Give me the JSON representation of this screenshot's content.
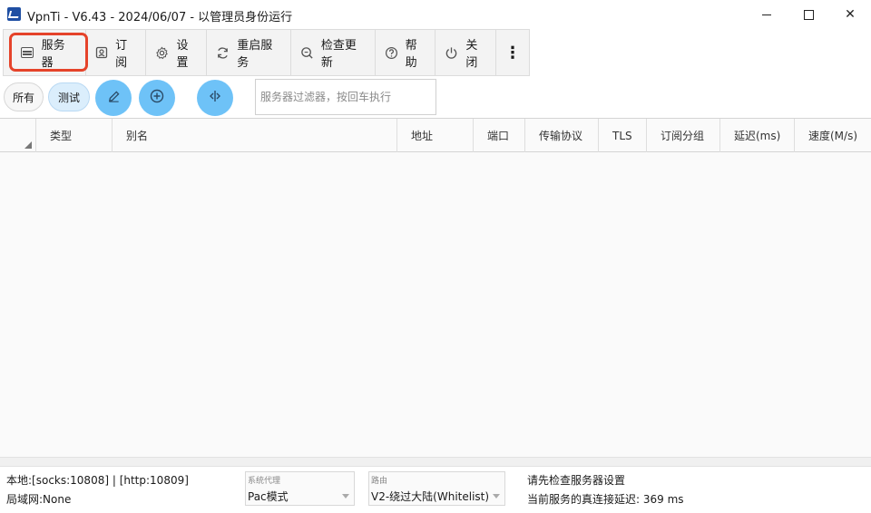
{
  "window": {
    "title": "VpnTi - V6.43 - 2024/06/07 - 以管理员身份运行",
    "controls": {
      "minimize": "",
      "maximize": "",
      "close": "✕"
    }
  },
  "toolbar": {
    "items": [
      {
        "label": "服务器",
        "icon": "server-icon"
      },
      {
        "label": "订阅",
        "icon": "subscription-icon"
      },
      {
        "label": "设置",
        "icon": "gear-icon"
      },
      {
        "label": "重启服务",
        "icon": "refresh-icon"
      },
      {
        "label": "检查更新",
        "icon": "update-search-icon"
      },
      {
        "label": "帮助",
        "icon": "help-icon"
      },
      {
        "label": "关闭",
        "icon": "power-icon"
      }
    ],
    "more": "⋮",
    "highlight_color": "#e5432a"
  },
  "filter": {
    "all_label": "所有",
    "test_label": "测试",
    "placeholder": "服务器过滤器，按回车执行",
    "accent_color": "#6ec2f7"
  },
  "table": {
    "columns": [
      "类型",
      "别名",
      "地址",
      "端口",
      "传输协议",
      "TLS",
      "订阅分组",
      "延迟(ms)",
      "速度(M/s)"
    ],
    "rows": []
  },
  "status": {
    "local": "本地:[socks:10808] | [http:10809]",
    "lan": "局域网:None",
    "proxy_label": "系统代理",
    "proxy_value": "Pac模式",
    "route_label": "路由",
    "route_value": "V2-绕过大陆(Whitelist)",
    "message1": "请先检查服务器设置",
    "message2": "当前服务的真连接延迟: 369 ms"
  }
}
